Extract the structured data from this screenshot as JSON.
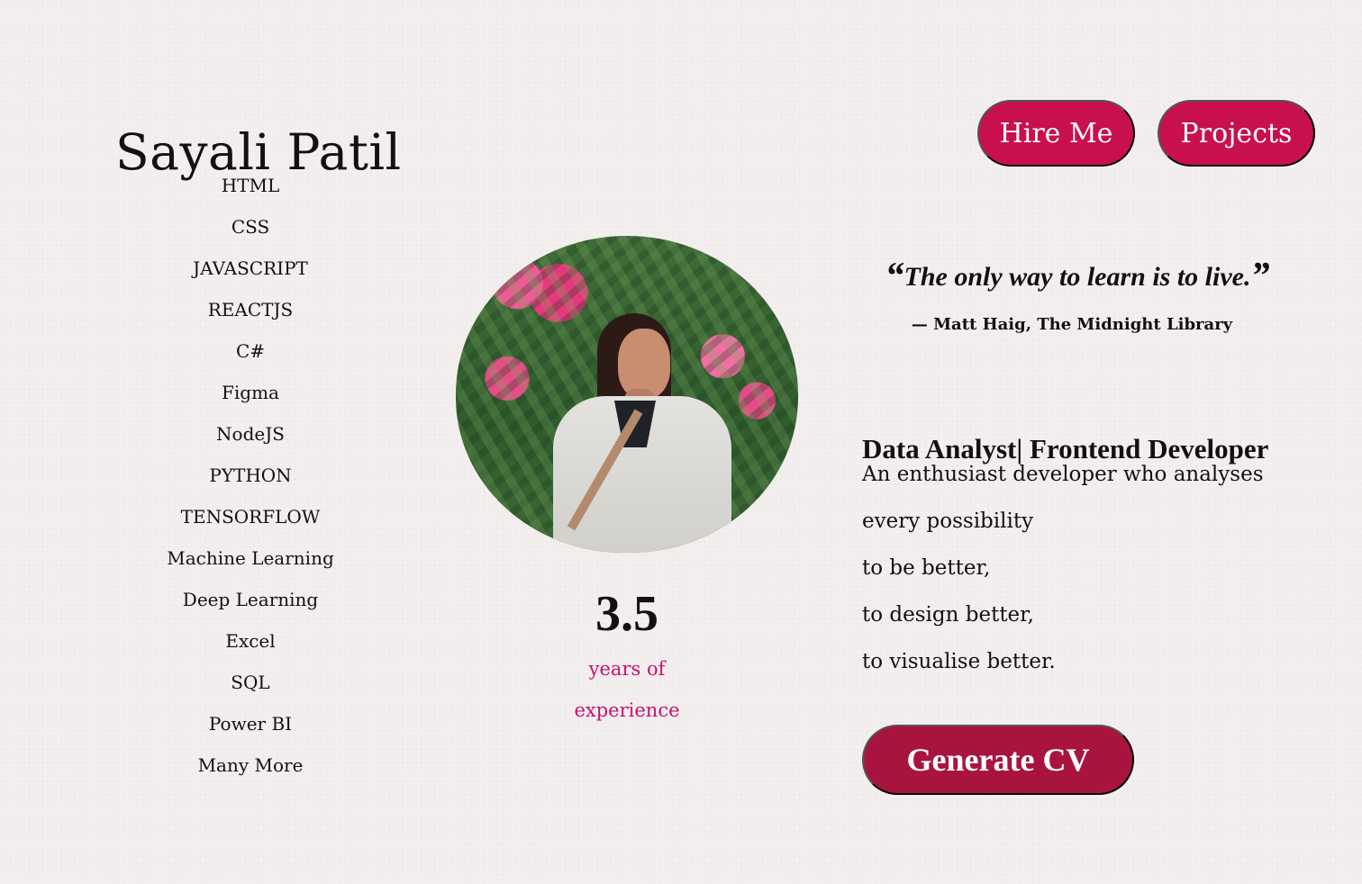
{
  "header": {
    "name": "Sayali Patil",
    "hire_label": "Hire Me",
    "projects_label": "Projects"
  },
  "skills": [
    "HTML",
    "CSS",
    "JAVASCRIPT",
    "REACTJS",
    "C#",
    "Figma",
    "NodeJS",
    "PYTHON",
    "TENSORFLOW",
    "Machine Learning",
    "Deep Learning",
    "Excel",
    "SQL",
    "Power BI",
    "Many More"
  ],
  "experience": {
    "value": "3.5",
    "line1": "years of",
    "line2": "experience"
  },
  "quote": {
    "text": "The only way to learn is to live.",
    "author": "— Matt Haig, The Midnight Library"
  },
  "about": {
    "role": "Data Analyst| Frontend Developer",
    "lines": [
      "An enthusiast developer who analyses",
      "every possibility",
      "to be better,",
      "to design better,",
      "to visualise better."
    ],
    "generate_label": "Generate CV"
  },
  "colors": {
    "accent": "#c8104e",
    "cv_button": "#a9143f",
    "experience_text": "#c8106f",
    "background": "#f3efee"
  }
}
